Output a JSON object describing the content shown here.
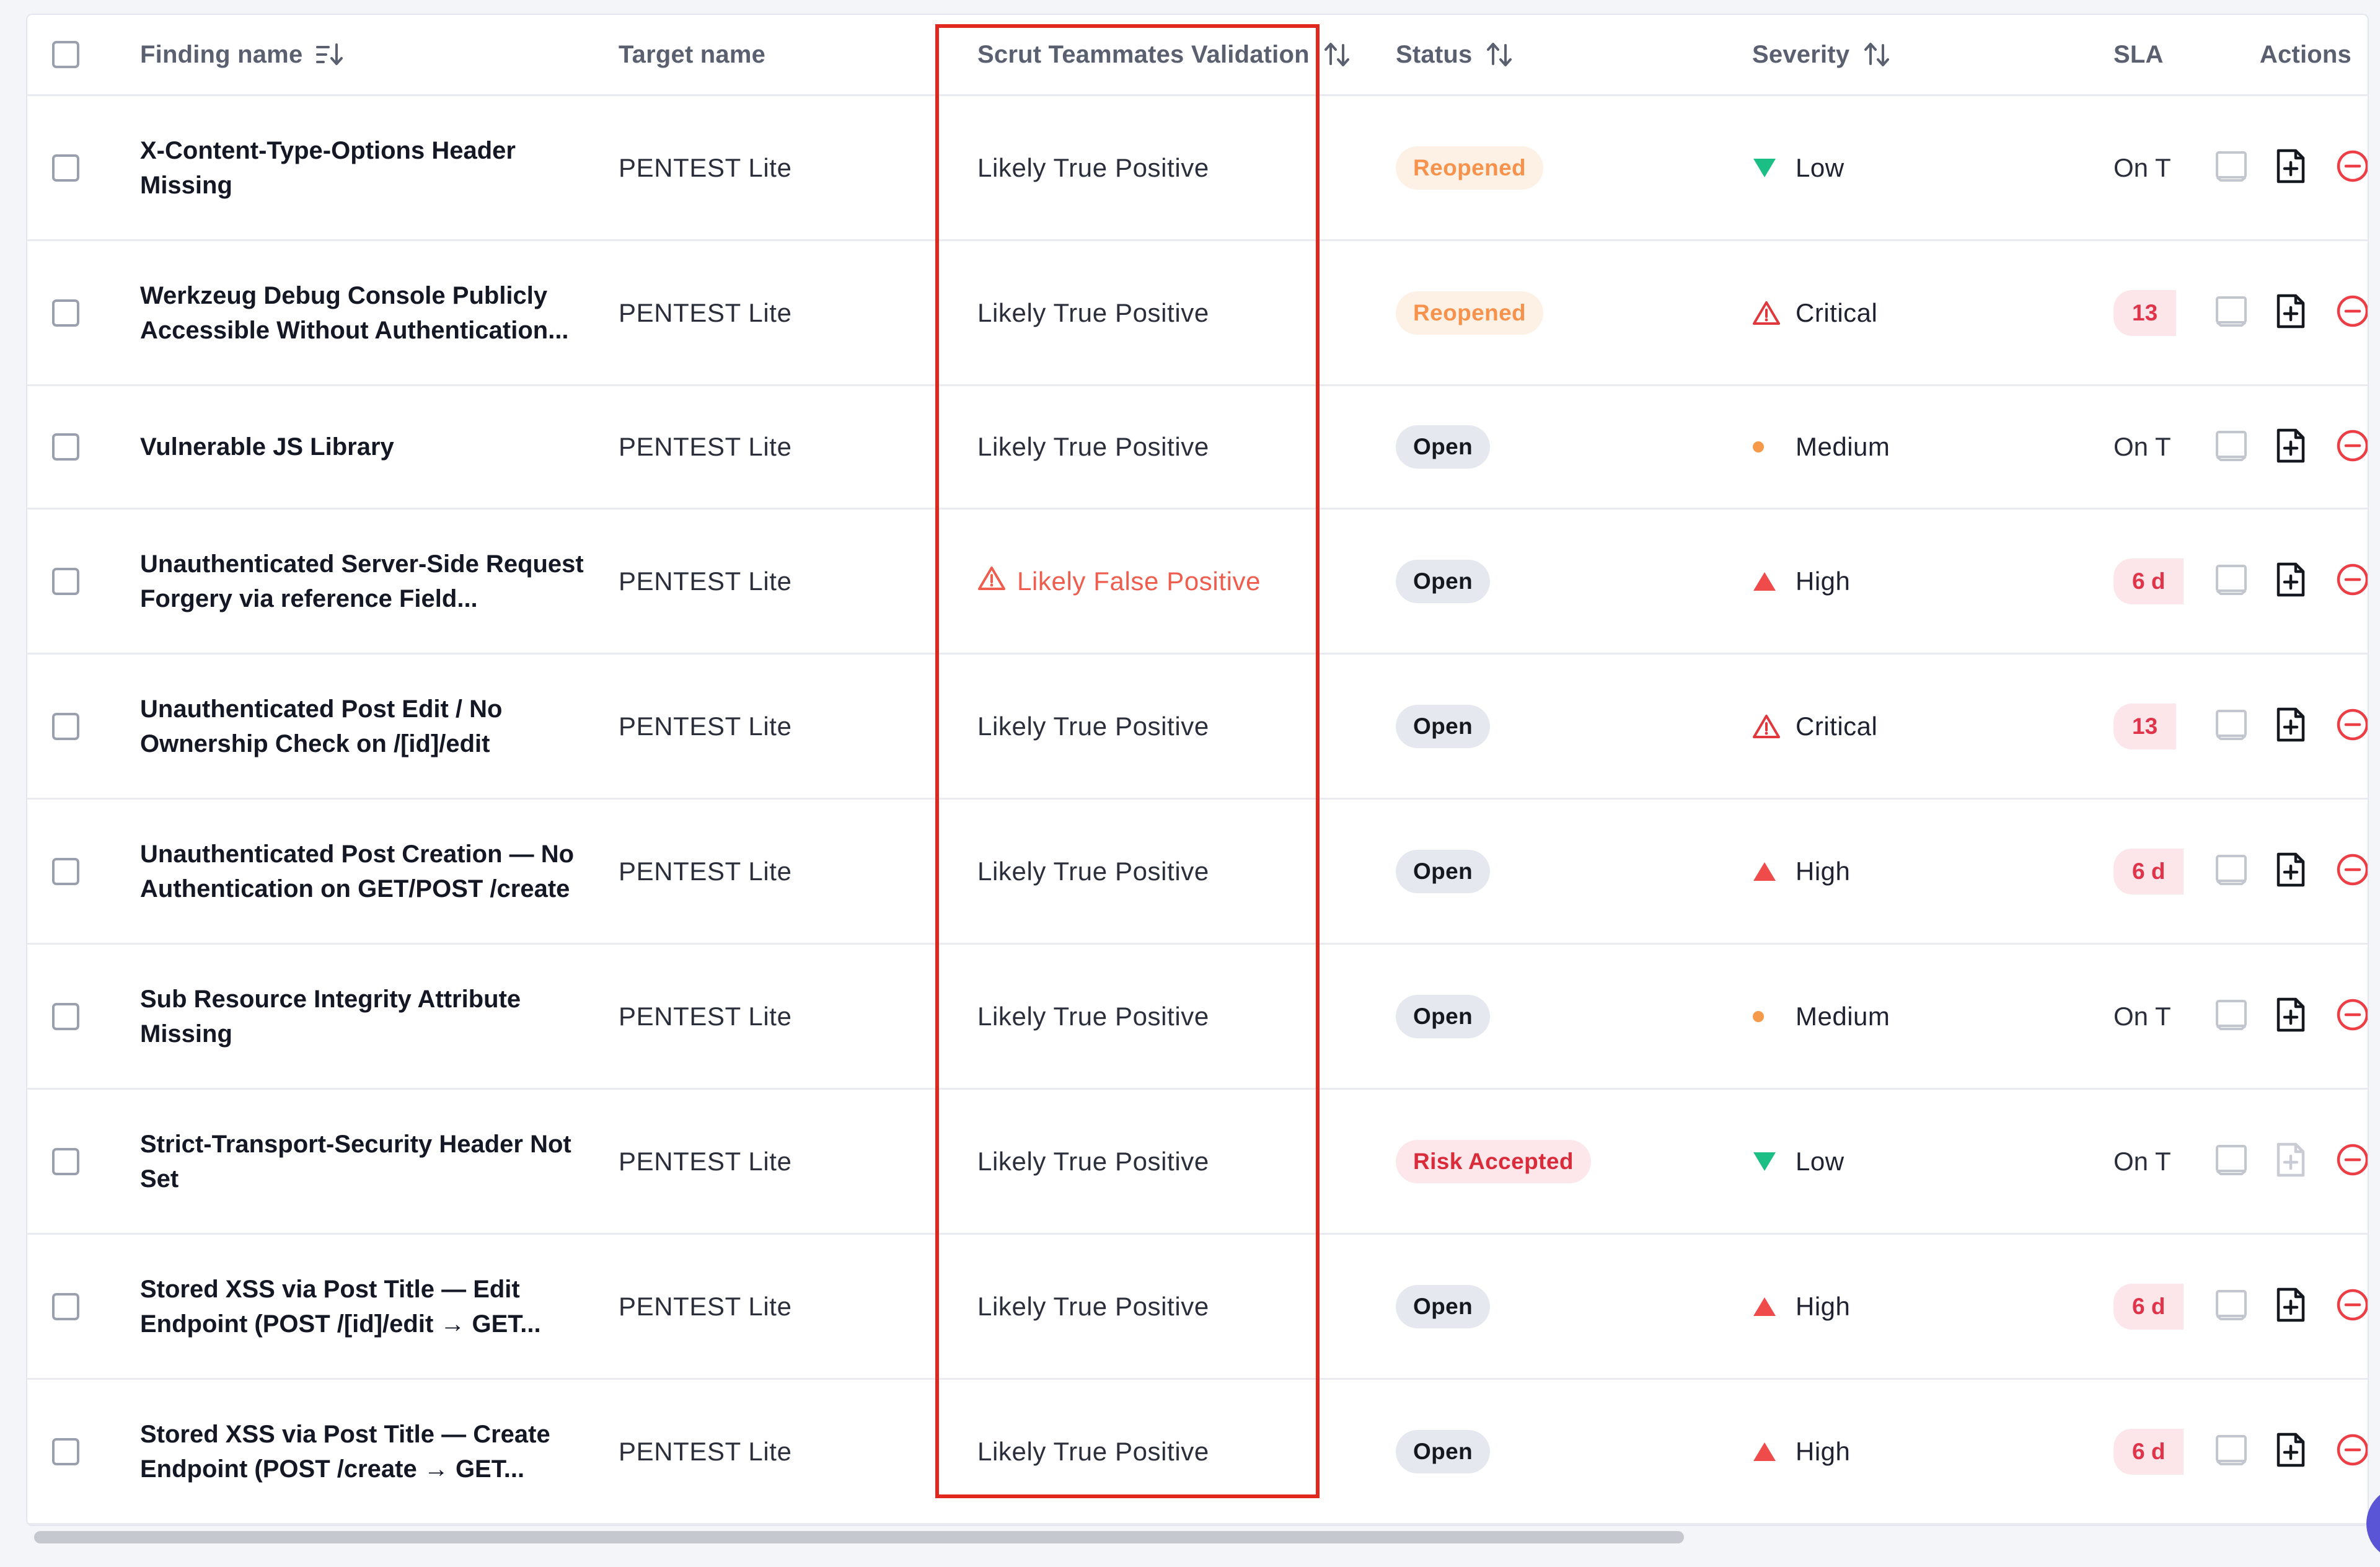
{
  "colors": {
    "accent_red": "#e0281f",
    "severity_green": "#1bbf86",
    "severity_red": "#ef4b4b",
    "severity_orange": "#f59a4a"
  },
  "header": {
    "finding_name": "Finding name",
    "target_name": "Target name",
    "validation": "Scrut Teammates Validation",
    "status": "Status",
    "severity": "Severity",
    "sla": "SLA",
    "actions": "Actions"
  },
  "rows": [
    {
      "name": "X-Content-Type-Options Header Missing",
      "target": "PENTEST Lite",
      "validation": "Likely True Positive",
      "status": "Reopened",
      "status_kind": "reopened",
      "severity": "Low",
      "severity_icon": "triangle-down-green",
      "sla": "On T",
      "sla_kind": "text",
      "action2_enabled": true
    },
    {
      "name": "Werkzeug Debug Console Publicly Accessible Without Authentication...",
      "target": "PENTEST Lite",
      "validation": "Likely True Positive",
      "status": "Reopened",
      "status_kind": "reopened",
      "severity": "Critical",
      "severity_icon": "warning-outline-red",
      "sla": "13",
      "sla_kind": "pill",
      "action2_enabled": true
    },
    {
      "name": "Vulnerable JS Library",
      "target": "PENTEST Lite",
      "validation": "Likely True Positive",
      "status": "Open",
      "status_kind": "open",
      "severity": "Medium",
      "severity_icon": "dot-orange",
      "sla": "On T",
      "sla_kind": "text",
      "action2_enabled": true
    },
    {
      "name": "Unauthenticated Server-Side Request Forgery via reference Field...",
      "target": "PENTEST Lite",
      "validation": "Likely False Positive",
      "status": "Open",
      "status_kind": "open",
      "severity": "High",
      "severity_icon": "triangle-up-red",
      "sla": "6 d",
      "sla_kind": "pill",
      "action2_enabled": true
    },
    {
      "name": "Unauthenticated Post Edit / No Ownership Check on /[id]/edit",
      "target": "PENTEST Lite",
      "validation": "Likely True Positive",
      "status": "Open",
      "status_kind": "open",
      "severity": "Critical",
      "severity_icon": "warning-outline-red",
      "sla": "13",
      "sla_kind": "pill",
      "action2_enabled": true
    },
    {
      "name": "Unauthenticated Post Creation — No Authentication on GET/POST /create",
      "target": "PENTEST Lite",
      "validation": "Likely True Positive",
      "status": "Open",
      "status_kind": "open",
      "severity": "High",
      "severity_icon": "triangle-up-red",
      "sla": "6 d",
      "sla_kind": "pill",
      "action2_enabled": true
    },
    {
      "name": "Sub Resource Integrity Attribute Missing",
      "target": "PENTEST Lite",
      "validation": "Likely True Positive",
      "status": "Open",
      "status_kind": "open",
      "severity": "Medium",
      "severity_icon": "dot-orange",
      "sla": "On T",
      "sla_kind": "text",
      "action2_enabled": true
    },
    {
      "name": "Strict-Transport-Security Header Not Set",
      "target": "PENTEST Lite",
      "validation": "Likely True Positive",
      "status": "Risk Accepted",
      "status_kind": "risk",
      "severity": "Low",
      "severity_icon": "triangle-down-green",
      "sla": "On T",
      "sla_kind": "text",
      "action2_enabled": false
    },
    {
      "name": "Stored XSS via Post Title — Edit Endpoint (POST /[id]/edit → GET...",
      "target": "PENTEST Lite",
      "validation": "Likely True Positive",
      "status": "Open",
      "status_kind": "open",
      "severity": "High",
      "severity_icon": "triangle-up-red",
      "sla": "6 d",
      "sla_kind": "pill",
      "action2_enabled": true
    },
    {
      "name": "Stored XSS via Post Title — Create Endpoint (POST /create → GET...",
      "target": "PENTEST Lite",
      "validation": "Likely True Positive",
      "status": "Open",
      "status_kind": "open",
      "severity": "High",
      "severity_icon": "triangle-up-red",
      "sla": "6 d",
      "sla_kind": "pill",
      "action2_enabled": true
    }
  ]
}
